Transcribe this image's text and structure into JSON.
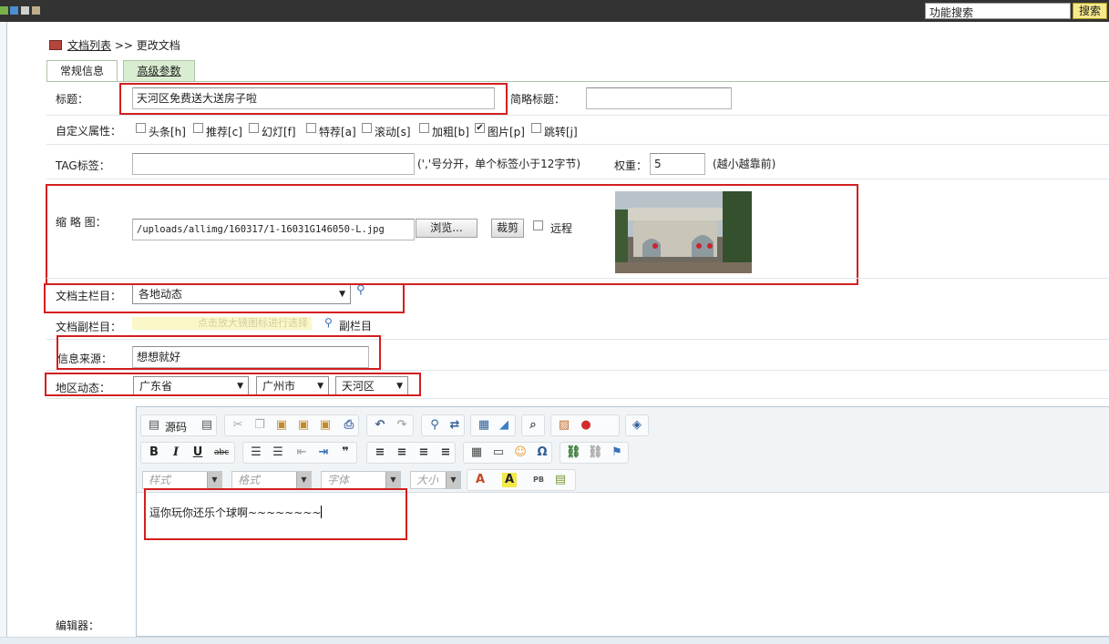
{
  "topbar": {
    "search_value": "功能搜索",
    "search_button": "搜索"
  },
  "breadcrumb": {
    "link": "文档列表",
    "separator": ">>",
    "current": "更改文档"
  },
  "tabs": [
    {
      "label": "常规信息"
    },
    {
      "label": "高级参数"
    }
  ],
  "form": {
    "title_label": "标题：",
    "title_value": "天河区免费送大送房子啦",
    "short_title_label": "简略标题：",
    "short_title_value": "",
    "attr_label": "自定义属性：",
    "attrs": [
      {
        "label": "头条[h]",
        "checked": false
      },
      {
        "label": "推荐[c]",
        "checked": false
      },
      {
        "label": "幻灯[f]",
        "checked": false
      },
      {
        "label": "特荐[a]",
        "checked": false
      },
      {
        "label": "滚动[s]",
        "checked": false
      },
      {
        "label": "加粗[b]",
        "checked": false
      },
      {
        "label": "图片[p]",
        "checked": true
      },
      {
        "label": "跳转[j]",
        "checked": false
      }
    ],
    "tag_label": "TAG标签：",
    "tag_value": "",
    "tag_hint": "(','号分开，单个标签小于12字节)",
    "weight_label": "权重：",
    "weight_value": "5",
    "weight_hint": "(越小越靠前)",
    "thumb_label": "缩 略 图：",
    "thumb_path": "/uploads/allimg/160317/1-16031G146050-L.jpg",
    "browse_button": "浏览...",
    "crop_button": "裁剪",
    "remote_label": "远程",
    "main_column_label": "文档主栏目：",
    "main_column_value": "各地动态",
    "sub_column_label": "文档副栏目：",
    "sub_column_placeholder": "点击放大镜图标进行选择",
    "sub_column_link": "副栏目",
    "source_label": "信息来源：",
    "source_value": "想想就好",
    "region_label": "地区动态：",
    "province": "广东省",
    "city": "广州市",
    "district": "天河区",
    "editor_label": "编辑器："
  },
  "editor": {
    "source_button": "源码",
    "style_combo": "样式",
    "format_combo": "格式",
    "font_combo": "字体",
    "size_combo": "大小",
    "content": "逗你玩你还乐个球啊~~~~~~~~"
  },
  "colors": {
    "highlight": "#d21f1f",
    "tab_active_bg": "#d9edd0",
    "search_button_bg": "#f5e98c"
  }
}
